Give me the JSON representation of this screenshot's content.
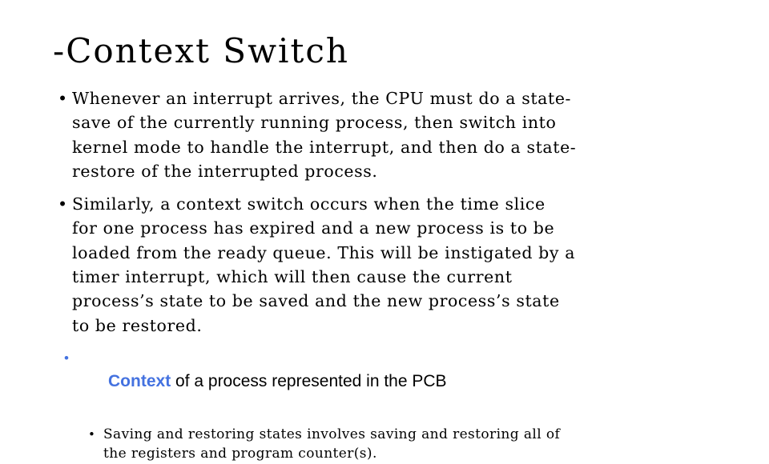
{
  "slide": {
    "title": "-Context Switch",
    "background_color": "#ffffff",
    "text_color": "#000000",
    "accent_color": "#4472E0",
    "bullet_glyph": "•"
  },
  "body": {
    "bullet1": {
      "lines": [
        "Whenever an interrupt arrives, the CPU must do a state-",
        "save of the currently running process, then switch into",
        "kernel mode to handle the interrupt, and then do a state-",
        "restore of the interrupted process."
      ],
      "full_text": "Whenever an interrupt arrives, the CPU must do a state-save of the currently running process, then switch into kernel mode to handle the interrupt, and then do a state-restore of the interrupted process."
    },
    "bullet2": {
      "lines": [
        "Similarly, a context switch occurs when the time slice",
        "for one process has expired and a new process is to be",
        "loaded from the ready queue. This will be instigated by a",
        "timer interrupt, which will then cause the current",
        "process’s state to be saved and the new process’s state",
        "to be restored."
      ],
      "full_text": "Similarly, a context switch occurs when the time slice for one process has expired and a new process is to be loaded from the ready queue. This will be instigated by a timer interrupt, which will then cause the current process’s state to be saved and the new process’s state to be restored."
    },
    "bullet3": {
      "highlight": "Context",
      "rest": " of a process represented in the PCB",
      "full_text": "Context of a process represented in the PCB"
    },
    "bullet4": {
      "lines": [
        "Saving and restoring states involves saving and restoring all of",
        "the registers and program counter(s)."
      ],
      "full_text": "Saving and restoring states involves saving and restoring all of the registers and program counter(s)."
    }
  }
}
